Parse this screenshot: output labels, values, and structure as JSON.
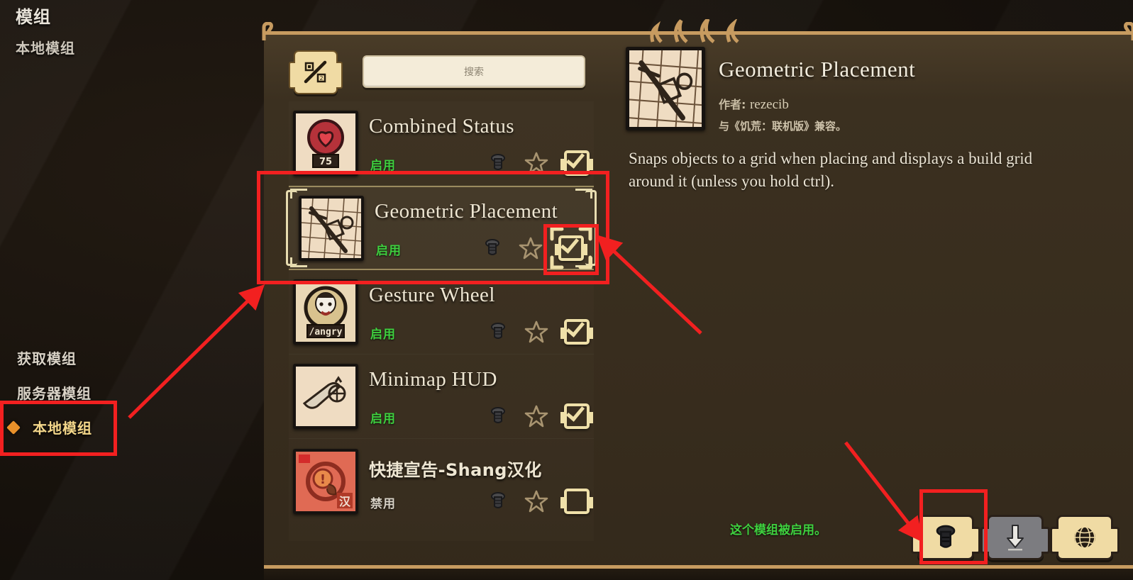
{
  "sidebar": {
    "title": "模组",
    "subtitle": "本地模组",
    "items": [
      {
        "label": "获取模组",
        "selected": false
      },
      {
        "label": "服务器模组",
        "selected": false
      },
      {
        "label": "本地模组",
        "selected": true
      }
    ]
  },
  "toolbar": {
    "sort_icon": "sort-slash-icon",
    "search_placeholder": "搜索",
    "search_value": ""
  },
  "mods": [
    {
      "name": "Combined Status",
      "status": "启用",
      "enabled": true,
      "checked": true,
      "selected": false,
      "thumb": "heart-badge-75-icon",
      "badge": "75"
    },
    {
      "name": "Geometric Placement",
      "status": "启用",
      "enabled": true,
      "checked": true,
      "selected": true,
      "thumb": "grid-ruler-icon",
      "badge": ""
    },
    {
      "name": "Gesture Wheel",
      "status": "启用",
      "enabled": true,
      "checked": true,
      "selected": false,
      "thumb": "angry-face-icon",
      "badge": "/angry"
    },
    {
      "name": "Minimap HUD",
      "status": "启用",
      "enabled": true,
      "checked": true,
      "selected": false,
      "thumb": "scroll-map-icon",
      "badge": ""
    },
    {
      "name": "快捷宣告-Shang汉化",
      "status": "禁用",
      "enabled": false,
      "checked": false,
      "selected": false,
      "thumb": "red-announce-icon",
      "badge": "汉"
    }
  ],
  "detail": {
    "title": "Geometric Placement",
    "author_label": "作者:",
    "author": "rezecib",
    "compatibility": "与《饥荒：联机版》兼容。",
    "description": "Snaps objects to a grid when placing and displays a build grid around it (unless you hold ctrl).",
    "status_note": "这个模组被启用。"
  },
  "bottom_buttons": [
    {
      "icon": "bolt-config-icon",
      "style": "gold",
      "highlighted": true
    },
    {
      "icon": "download-arrow-icon",
      "style": "grey",
      "highlighted": false
    },
    {
      "icon": "globe-icon",
      "style": "gold",
      "highlighted": false
    }
  ],
  "row_icons": {
    "config": "bolt-icon",
    "favorite": "star-icon",
    "toggle": "checkbox-icon"
  },
  "colors": {
    "accent_gold": "#efe0a9",
    "enabled_green": "#3fd03f",
    "annotation_red": "#f22020",
    "panel_bg": "#372c1d",
    "panel_border": "#c79b60"
  }
}
